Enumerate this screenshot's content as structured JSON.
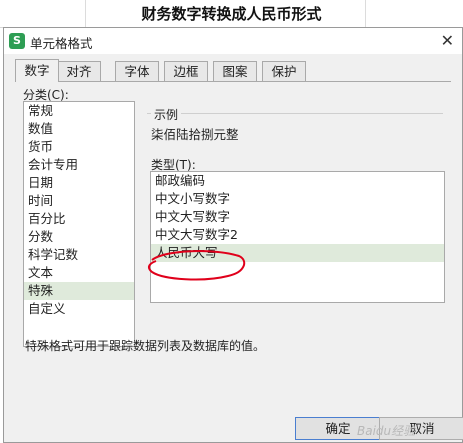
{
  "sheet": {
    "title": "财务数字转换成人民币形式"
  },
  "dialog": {
    "title": "单元格格式",
    "close_glyph": "✕",
    "app_icon_glyph": "S"
  },
  "tabs": [
    {
      "label": "数字",
      "active": true
    },
    {
      "label": "对齐"
    },
    {
      "label": "字体"
    },
    {
      "label": "边框"
    },
    {
      "label": "图案"
    },
    {
      "label": "保护"
    }
  ],
  "category": {
    "label": "分类(C):",
    "items": [
      "常规",
      "数值",
      "货币",
      "会计专用",
      "日期",
      "时间",
      "百分比",
      "分数",
      "科学记数",
      "文本",
      "特殊",
      "自定义"
    ],
    "selected_index": 10
  },
  "sample": {
    "label": "示例",
    "value": "柒佰陆拾捌元整"
  },
  "type": {
    "label": "类型(T):",
    "items": [
      "邮政编码",
      "中文小写数字",
      "中文大写数字",
      "中文大写数字2",
      "人民币大写"
    ],
    "selected_index": 4
  },
  "description": "特殊格式可用于跟踪数据列表及数据库的值。",
  "buttons": {
    "ok": "确定",
    "cancel": "取消"
  },
  "watermark": "Baidu经验",
  "colors": {
    "selected_row": "#dfeadb",
    "annotation": "#e0001b",
    "app_icon": "#2e9e54"
  }
}
